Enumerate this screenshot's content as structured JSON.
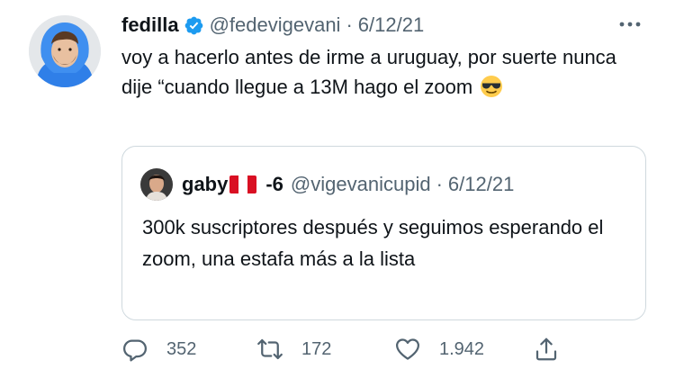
{
  "tweet": {
    "author": {
      "name": "fedilla",
      "handle": "@fedevigevani",
      "verified": true
    },
    "separator": "·",
    "date": "6/12/21",
    "text": "voy a hacerlo antes de irme a uruguay, por suerte nunca dije “cuando llegue a 13M hago el zoom",
    "emoji": "smiling-face-with-sunglasses",
    "quoted": {
      "name": "gaby",
      "flag": "peru-flag",
      "name_suffix": "-6",
      "handle": "@vigevanicupid",
      "separator": "·",
      "date": "6/12/21",
      "text": "300k suscriptores después y seguimos esperando el zoom, una estafa más a la lista"
    },
    "actions": {
      "replies": "352",
      "retweets": "172",
      "likes": "1.942"
    }
  },
  "colors": {
    "text": "#0f1419",
    "secondary": "#536471",
    "verified": "#1d9bf0",
    "border": "#cfd9de"
  }
}
